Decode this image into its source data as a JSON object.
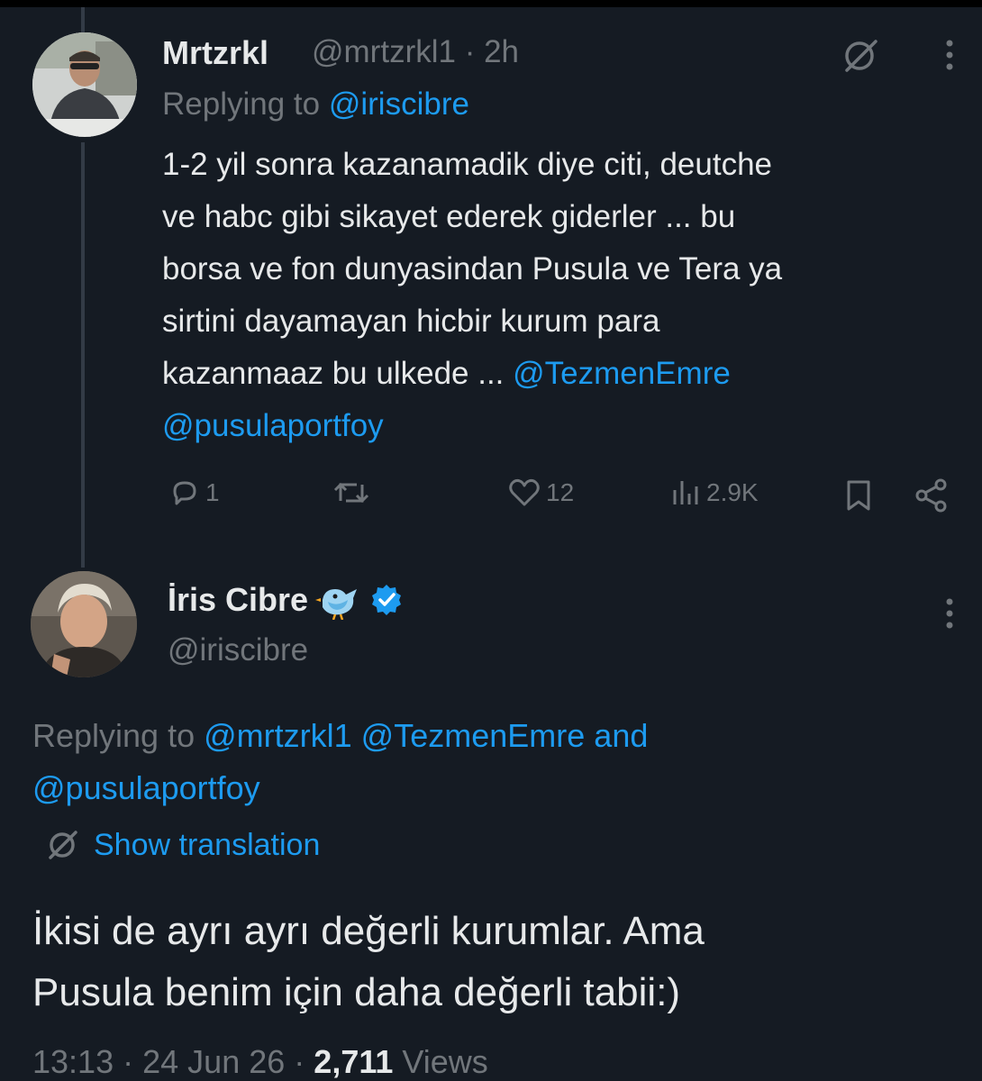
{
  "colors": {
    "background": "#151b23",
    "text": "#e7e9ea",
    "muted": "#71767b",
    "link": "#1d9bf0",
    "verified": "#1d9bf0"
  },
  "reply_tweet": {
    "author_name": "Mrtzrkl",
    "handle": "@mrtzrkl1",
    "separator": "·",
    "time": "2h",
    "replying_prefix": "Replying to",
    "replying_to": "@iriscibre",
    "text_lines": [
      "1-2 yil sonra kazanamadik diye citi, deutche",
      "ve habc gibi sikayet ederek giderler ... bu",
      "borsa ve fon dunyasindan Pusula ve Tera ya",
      "sirtini dayamayan hicbir kurum para",
      "kazanmaaz bu ulkede ... "
    ],
    "mention_1": "@TezmenEmre",
    "mention_2": "@pusulaportfoy",
    "actions": {
      "replies": "1",
      "retweets": "",
      "likes": "12",
      "views": "2.9K"
    },
    "icons": [
      "grok-icon",
      "more-icon",
      "reply-icon",
      "retweet-icon",
      "like-icon",
      "views-icon",
      "bookmark-icon",
      "share-icon"
    ]
  },
  "main_tweet": {
    "author_name": "İris Cibre",
    "handle": "@iriscibre",
    "replying_prefix": "Replying to",
    "replying_to_1": "@mrtzrkl1",
    "replying_to_2": "@TezmenEmre",
    "and_word": "and",
    "replying_to_3": "@pusulaportfoy",
    "show_translation": "Show translation",
    "text_line_1": "İkisi de ayrı ayrı değerli kurumlar. Ama",
    "text_line_2": "Pusula benim için daha değerli tabii:)",
    "time": "13:13",
    "date": "24 Jun 26",
    "dot": "·",
    "views_count": "2,711",
    "views_label": "Views",
    "icons": [
      "bird-emoji-icon",
      "verified-badge-icon",
      "more-icon",
      "translate-icon"
    ]
  }
}
